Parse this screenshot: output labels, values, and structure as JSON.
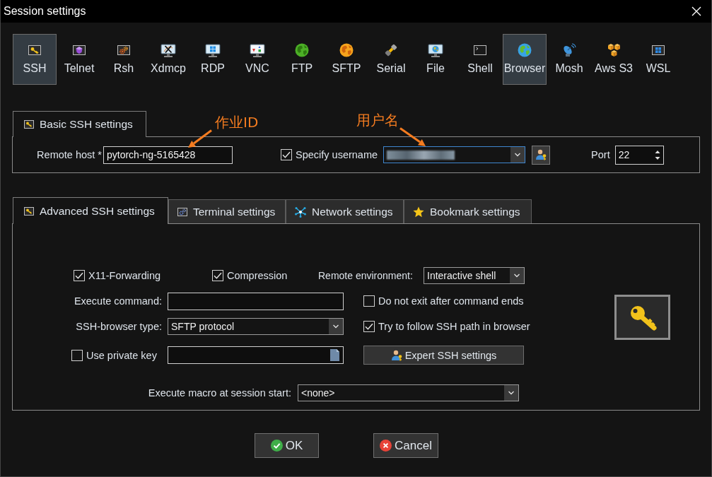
{
  "window": {
    "title": "Session settings"
  },
  "session_types": [
    {
      "label": "SSH",
      "selected": true,
      "hovered": false
    },
    {
      "label": "Telnet",
      "selected": false,
      "hovered": false
    },
    {
      "label": "Rsh",
      "selected": false,
      "hovered": false
    },
    {
      "label": "Xdmcp",
      "selected": false,
      "hovered": false
    },
    {
      "label": "RDP",
      "selected": false,
      "hovered": false
    },
    {
      "label": "VNC",
      "selected": false,
      "hovered": false
    },
    {
      "label": "FTP",
      "selected": false,
      "hovered": false
    },
    {
      "label": "SFTP",
      "selected": false,
      "hovered": false
    },
    {
      "label": "Serial",
      "selected": false,
      "hovered": false
    },
    {
      "label": "File",
      "selected": false,
      "hovered": false
    },
    {
      "label": "Shell",
      "selected": false,
      "hovered": false
    },
    {
      "label": "Browser",
      "selected": false,
      "hovered": true
    },
    {
      "label": "Mosh",
      "selected": false,
      "hovered": false
    },
    {
      "label": "Aws S3",
      "selected": false,
      "hovered": false
    },
    {
      "label": "WSL",
      "selected": false,
      "hovered": false
    }
  ],
  "basic_settings": {
    "tab": "Basic SSH settings",
    "remote_host": {
      "label": "Remote host *",
      "value": "pytorch-ng-5165428"
    },
    "specify_username": {
      "label": "Specify username",
      "checked": true
    },
    "username": {
      "redacted": true,
      "focused": true
    },
    "port": {
      "label": "Port",
      "value": "22"
    }
  },
  "annotations": [
    {
      "text": "作业ID"
    },
    {
      "text": "用户名"
    }
  ],
  "tabs": [
    {
      "label": "Advanced SSH settings",
      "selected": true
    },
    {
      "label": "Terminal settings",
      "selected": false
    },
    {
      "label": "Network settings",
      "selected": false
    },
    {
      "label": "Bookmark settings",
      "selected": false
    }
  ],
  "advanced_ssh_settings": {
    "x11_forwarding": {
      "label": "X11-Forwarding",
      "checked": true
    },
    "compression": {
      "label": "Compression",
      "checked": true
    },
    "remote_environment": {
      "label": "Remote environment:",
      "value": "Interactive shell"
    },
    "execute_command": {
      "label": "Execute command:"
    },
    "do_not_exit": {
      "label": "Do not exit after command ends",
      "checked": false
    },
    "ssh_browser_type": {
      "label": "SSH-browser type:",
      "value": "SFTP protocol"
    },
    "follow_ssh_path": {
      "label": "Try to follow SSH path in browser",
      "checked": true
    },
    "use_private_key": {
      "label": "Use private key",
      "checked": false
    },
    "expert_button": {
      "label": "Expert SSH settings"
    },
    "macro": {
      "label": "Execute macro at session start:",
      "value": "<none>"
    }
  },
  "buttons": [
    {
      "label": "OK",
      "kind": "ok"
    },
    {
      "label": "Cancel",
      "kind": "cancel"
    }
  ]
}
